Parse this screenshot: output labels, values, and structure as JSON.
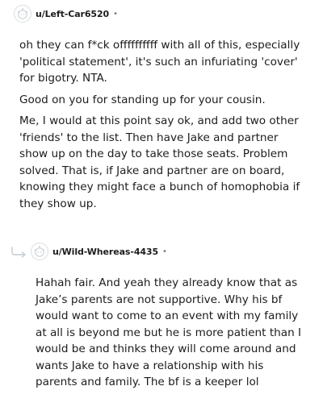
{
  "comments": [
    {
      "username": "u/Left-Car6520",
      "separator": "•",
      "paragraphs": [
        "oh they can f*ck offffffffff with all of this, especially 'political statement', it's such an infuriating 'cover' for bigotry. NTA.",
        "Good on you for standing up for your cousin.",
        "Me, I would at this point say ok, and add two other 'friends' to the list. Then have Jake and partner show up on the day to take those seats. Problem solved. That is, if Jake and partner are on board, knowing they might face a bunch of homophobia if they show up."
      ]
    },
    {
      "username": "u/Wild-Whereas-4435",
      "separator": "•",
      "paragraphs": [
        "Hahah fair. And yeah they already know that as Jake’s parents are not supportive. Why his bf would want to come to an event with my family at all is beyond me but he is more patient than I would be and thinks they will come around and wants Jake to have a relationship with his parents and family. The bf is a keeper lol"
      ]
    }
  ],
  "icons": {
    "avatar": "snoo-avatar-icon",
    "reply": "reply-thread-arrow-icon"
  },
  "colors": {
    "text": "#1c1c1c",
    "muted": "#7c7c7c",
    "thread_line": "#c4cbd1"
  }
}
